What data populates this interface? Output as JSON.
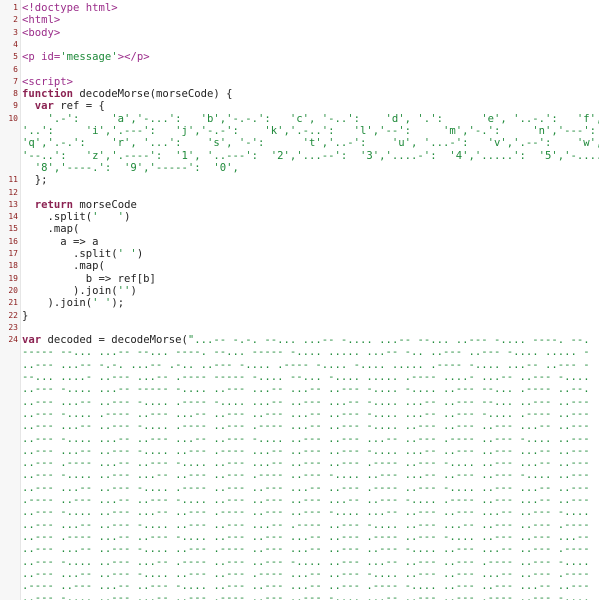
{
  "editor": {
    "lines": [
      {
        "num": "1",
        "segments": [
          {
            "t": "<!doctype html>",
            "c": "tag"
          }
        ]
      },
      {
        "num": "2",
        "segments": [
          {
            "t": "<html>",
            "c": "tag"
          }
        ]
      },
      {
        "num": "3",
        "segments": [
          {
            "t": "<body>",
            "c": "tag"
          }
        ]
      },
      {
        "num": "4",
        "segments": []
      },
      {
        "num": "5",
        "segments": [
          {
            "t": "<p id=",
            "c": "tag"
          },
          {
            "t": "'message'",
            "c": "str"
          },
          {
            "t": "></p>",
            "c": "tag"
          }
        ]
      },
      {
        "num": "6",
        "segments": []
      },
      {
        "num": "7",
        "segments": [
          {
            "t": "<script>",
            "c": "tag"
          }
        ]
      },
      {
        "num": "8",
        "segments": [
          {
            "t": "function",
            "c": "kw"
          },
          {
            "t": " decodeMorse(morseCode) {",
            "c": "norm"
          }
        ]
      },
      {
        "num": "9",
        "segments": [
          {
            "t": "  ",
            "c": "norm"
          },
          {
            "t": "var",
            "c": "kw"
          },
          {
            "t": " ref = {",
            "c": "norm"
          }
        ]
      },
      {
        "num": "10",
        "segments": [
          {
            "t": "    '.-':     'a','-...':   'b','-.-.':   'c', '-..':    'd', '.':      'e', '..-.':   'f',",
            "c": "str"
          }
        ]
      },
      {
        "num": "",
        "segments": [
          {
            "t": "'..':     'i','.---':   'j','-.-':    'k','.-..':   'l','--':     'm','-.':     'n','---':",
            "c": "str"
          }
        ]
      },
      {
        "num": "",
        "segments": [
          {
            "t": "'q','.-.':    'r', '...':    's', '-':      't','..-':    'u', '...-':   'v','.--':    'w',",
            "c": "str"
          }
        ]
      },
      {
        "num": "",
        "segments": [
          {
            "t": "'--..':   'z','.----':  '1', '..---':  '2','...--':  '3','....-':  '4','.....':  '5','-....':",
            "c": "str"
          }
        ]
      },
      {
        "num": "",
        "segments": [
          {
            "t": "  '8','----.':  '9','-----':  '0',",
            "c": "str"
          }
        ]
      },
      {
        "num": "11",
        "segments": [
          {
            "t": "  };",
            "c": "norm"
          }
        ]
      },
      {
        "num": "12",
        "segments": []
      },
      {
        "num": "13",
        "segments": [
          {
            "t": "  ",
            "c": "norm"
          },
          {
            "t": "return",
            "c": "kw"
          },
          {
            "t": " morseCode",
            "c": "norm"
          }
        ]
      },
      {
        "num": "14",
        "segments": [
          {
            "t": "    .split(",
            "c": "norm"
          },
          {
            "t": "'   '",
            "c": "str"
          },
          {
            "t": ")",
            "c": "norm"
          }
        ]
      },
      {
        "num": "15",
        "segments": [
          {
            "t": "    .map(",
            "c": "norm"
          }
        ]
      },
      {
        "num": "16",
        "segments": [
          {
            "t": "      a => a",
            "c": "norm"
          }
        ]
      },
      {
        "num": "17",
        "segments": [
          {
            "t": "        .split(",
            "c": "norm"
          },
          {
            "t": "' '",
            "c": "str"
          },
          {
            "t": ")",
            "c": "norm"
          }
        ]
      },
      {
        "num": "18",
        "segments": [
          {
            "t": "        .map(",
            "c": "norm"
          }
        ]
      },
      {
        "num": "19",
        "segments": [
          {
            "t": "          b => ref[b]",
            "c": "norm"
          }
        ]
      },
      {
        "num": "20",
        "segments": [
          {
            "t": "        ).join(",
            "c": "norm"
          },
          {
            "t": "''",
            "c": "str"
          },
          {
            "t": ")",
            "c": "norm"
          }
        ]
      },
      {
        "num": "21",
        "segments": [
          {
            "t": "    ).join(",
            "c": "norm"
          },
          {
            "t": "' '",
            "c": "str"
          },
          {
            "t": ");",
            "c": "norm"
          }
        ]
      },
      {
        "num": "22",
        "segments": [
          {
            "t": "}",
            "c": "norm"
          }
        ]
      },
      {
        "num": "23",
        "segments": []
      },
      {
        "num": "24",
        "segments": [
          {
            "t": "var",
            "c": "kw"
          },
          {
            "t": " decoded = decodeMorse(",
            "c": "norm"
          },
          {
            "t": "\"...-- -.-. --... ...-- -.... ...-- --... ..--- -.... ----. --.",
            "c": "str"
          }
        ]
      },
      {
        "num": "",
        "segments": [
          {
            "t": "----- --... ...-- --... ----. --... ----- -.... ..... ...-- -.. ..--- ..--- -.... ..... -",
            "c": "morse"
          }
        ]
      },
      {
        "num": "",
        "segments": [
          {
            "t": "..--- ...-- -.-. ...-- .-.. ..--- -.... .---- -.... -.... ..... .---- -.... ...-- ..--- -",
            "c": "morse"
          }
        ]
      },
      {
        "num": "",
        "segments": [
          {
            "t": "--... ....- ..--- ...-- .---- ----- -.... --... -.... ..... .---- ....- ...-- ..--- -....",
            "c": "morse"
          }
        ]
      },
      {
        "num": "",
        "segments": [
          {
            "t": "..--- -.... ...-- ----- -.... ..--- ...-- ...-- ..--- -.... -.... ..--- --... .---- ..--.",
            "c": "morse"
          }
        ]
      },
      {
        "num": "",
        "segments": [
          {
            "t": "..--- ...-- ..--- -.... .---- -.... ...-- ..--- ...-- -.... ...-- ..--- --... ..--- ..---",
            "c": "morse"
          }
        ]
      },
      {
        "num": "",
        "segments": [
          {
            "t": "..--- -.... .---- ..--- ...-- ..--- ..--- ...-- ..--- -.... ...-- ..--- -.... .---- ..---",
            "c": "morse"
          }
        ]
      },
      {
        "num": "",
        "segments": [
          {
            "t": "..--- ...-- ..--- -.... .---- ..--- .---- ...-- ..--- -.... ..--- ..--- ..--- ...-- ..---",
            "c": "morse"
          }
        ]
      },
      {
        "num": "",
        "segments": [
          {
            "t": "..--- -.... ...-- ..--- ...-- ..--- -.... ..--- ..--- ...-- ..--- .---- ..--- -.... ..---",
            "c": "morse"
          }
        ]
      },
      {
        "num": "",
        "segments": [
          {
            "t": "..--- ...-- ..--- -.... ..--- .---- ...-- ..--- ..--- -.... ...-- ..--- ..--- ...-- ..---",
            "c": "morse"
          }
        ]
      },
      {
        "num": "",
        "segments": [
          {
            "t": "..--- .---- ...-- ..--- -.... ..--- ...-- ..--- ..--- .---- ..--- -.... ..--- ...-- ..---",
            "c": "morse"
          }
        ]
      },
      {
        "num": "",
        "segments": [
          {
            "t": "..--- -.... ..--- ...-- ..--- ..--- .---- ..--- -.... ..--- ...-- ..--- ..--- -.... ..---",
            "c": "morse"
          }
        ]
      },
      {
        "num": "",
        "segments": [
          {
            "t": "..--- ...-- ..--- -.... .---- ..--- ..--- ...-- ..--- .---- ..--- -.... ..--- ...-- ..---",
            "c": "morse"
          }
        ]
      },
      {
        "num": "",
        "segments": [
          {
            "t": ".---- ..--- ...-- ..--- -.... ..--- ..--- ..--- ...-- ..--- -.... .---- ..--- ...-- ..---",
            "c": "morse"
          }
        ]
      },
      {
        "num": "",
        "segments": [
          {
            "t": "..--- -.... ..--- ...-- ..--- .---- ..--- ..--- -.... ...-- ..--- ..--- ...-- ..--- -....",
            "c": "morse"
          }
        ]
      },
      {
        "num": "",
        "segments": [
          {
            "t": "..--- ...-- ..--- -.... ..--- ..--- ...-- .---- ..--- -.... ..--- ...-- ..--- ..--- .----",
            "c": "morse"
          }
        ]
      },
      {
        "num": "",
        "segments": [
          {
            "t": "..--- .---- ...-- ..--- -.... ..--- ..--- ...-- ..--- .---- ..--- -.... ..--- ..--- ...--",
            "c": "morse"
          }
        ]
      },
      {
        "num": "",
        "segments": [
          {
            "t": "..--- ...-- ..--- -.... ..--- .---- ..--- ...-- ..--- ..--- -.... ..--- ...-- ..--- .----",
            "c": "morse"
          }
        ]
      },
      {
        "num": "",
        "segments": [
          {
            "t": "..--- -.... ..--- ...-- .---- ..--- ..--- -.... ..--- ...-- ..--- ..--- .---- ..--- -....",
            "c": "morse"
          }
        ]
      },
      {
        "num": "",
        "segments": [
          {
            "t": "..--- ...-- ..--- -.... ..--- ..--- .---- ...-- ..--- -.... ..--- ..--- ...-- ..--- .----",
            "c": "morse"
          }
        ]
      },
      {
        "num": "",
        "segments": [
          {
            "t": ".---- ..--- ...-- ..--- -.... ..--- ..--- ...-- ..--- .---- -.... ..--- ..--- ...-- ..---",
            "c": "morse"
          }
        ]
      },
      {
        "num": "",
        "segments": [
          {
            "t": "..--- -.... ..--- ...-- ..--- .---- ..--- ..--- -.... ...-- ..--- ..--- .---- ..--- -....",
            "c": "morse"
          }
        ]
      },
      {
        "num": "",
        "segments": [
          {
            "t": "..--- ...-- ..--- -.... .---- ..--- ..--- ...-- ..--- -.... ..--- ..--- .---- ..--- ...--",
            "c": "morse"
          }
        ]
      }
    ]
  }
}
